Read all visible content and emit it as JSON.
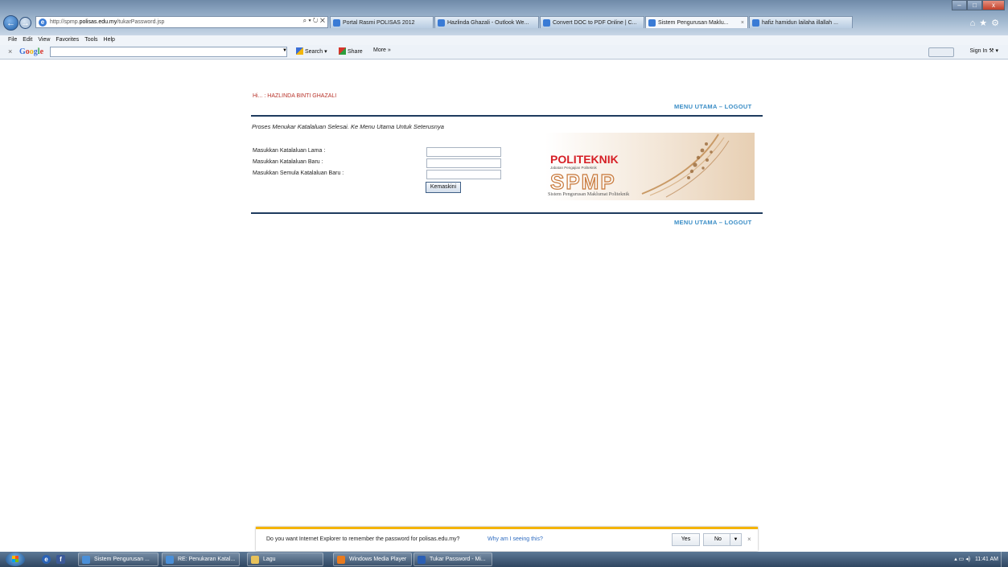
{
  "browser": {
    "url_prefix": "http://spmp.",
    "url_domain": "polisas.edu.my",
    "url_path": "/tukarPassword.jsp",
    "address_tools": "⌕ ▾ ↻ ✕",
    "tabs": [
      {
        "label": "Portal Rasmi POLISAS 2012",
        "color": "#3a7bd5"
      },
      {
        "label": "Hazlinda Ghazali - Outlook We...",
        "color": "#3a7bd5"
      },
      {
        "label": "Convert DOC to PDF Online | C...",
        "color": "#3a7bd5"
      },
      {
        "label": "Sistem Pengurusan Maklu...",
        "color": "#3a7bd5",
        "active": true
      },
      {
        "label": "hafiz hamidun lailaha illallah ...",
        "color": "#3a7bd5"
      }
    ],
    "menu": [
      "File",
      "Edit",
      "View",
      "Favorites",
      "Tools",
      "Help"
    ],
    "google_toolbar": {
      "close": "×",
      "logo": "Google",
      "search_label": "Search ▾",
      "share_label": "Share",
      "more_label": "More »",
      "signin_label": "Sign In ⚒ ▾"
    }
  },
  "page": {
    "greeting": "Hi... : HAZLINDA BINTI GHAZALI",
    "top_menu": "MENU UTAMA – LOGOUT",
    "bottom_menu": "MENU UTAMA – LOGOUT",
    "status_message": "Proses Menukar Katalaluan Selesai. Ke Menu Utama Untuk Seterusnya",
    "form": {
      "old_password_label": "Masukkan Katalaluan Lama :",
      "new_password_label": "Masukkan Katalaluan Baru :",
      "confirm_password_label": "Masukkan Semula Katalaluan Baru :",
      "submit_label": "Kemaskini"
    },
    "logo": {
      "brand": "POLITEKNIK",
      "subtitle": "Jabatan Pengajian Politeknik",
      "acronym": "SPMP",
      "tagline": "Sistem Pengurusan Maklumat Politeknik"
    }
  },
  "notification": {
    "text": "Do you want Internet Explorer to remember the password for polisas.edu.my?",
    "why_link": "Why am I seeing this?",
    "yes_label": "Yes",
    "no_label": "No",
    "close": "×"
  },
  "taskbar": {
    "items": [
      {
        "label": "Sistem Pengurusan ...",
        "color": "#4a8fd8"
      },
      {
        "label": "RE: Penukaran Katal...",
        "color": "#4a8fd8"
      },
      {
        "label": "Lagu",
        "color": "#e8c25a"
      },
      {
        "label": "Windows Media Player",
        "color": "#e87a1e"
      },
      {
        "label": "Tukar Password - Mi...",
        "color": "#2b5fb4"
      }
    ],
    "clock": "11:41 AM",
    "tray_icons": "▴  ▭  ◂)"
  },
  "colors": {
    "greeting": "#b8332a",
    "menu_link": "#3a8dc6",
    "rule": "#1e3b5e",
    "notify_accent": "#f4b400"
  }
}
